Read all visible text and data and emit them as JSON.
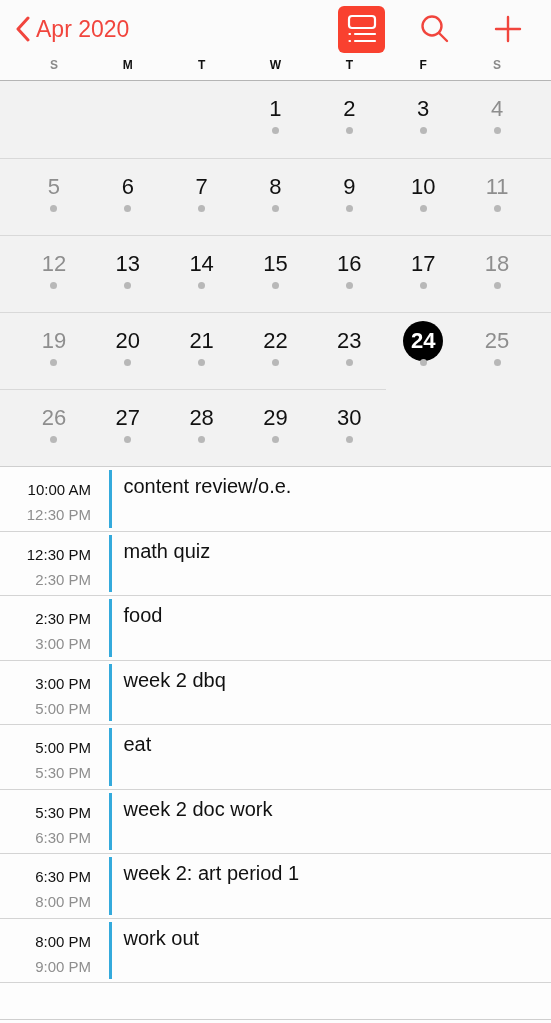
{
  "nav": {
    "back_label": "Apr 2020",
    "buttons": [
      {
        "kind": "list-view",
        "selected": true
      },
      {
        "kind": "search",
        "selected": false
      },
      {
        "kind": "add",
        "selected": false
      }
    ]
  },
  "weekdays": [
    {
      "label": "S",
      "weekend": true
    },
    {
      "label": "M",
      "weekend": false
    },
    {
      "label": "T",
      "weekend": false
    },
    {
      "label": "W",
      "weekend": false
    },
    {
      "label": "T",
      "weekend": false
    },
    {
      "label": "F",
      "weekend": false
    },
    {
      "label": "S",
      "weekend": true
    }
  ],
  "weeks": [
    [
      {
        "kind": "blank"
      },
      {
        "kind": "blank"
      },
      {
        "kind": "blank"
      },
      {
        "day": "1",
        "weekend": false,
        "selected": false,
        "has_events": true
      },
      {
        "day": "2",
        "weekend": false,
        "selected": false,
        "has_events": true
      },
      {
        "day": "3",
        "weekend": false,
        "selected": false,
        "has_events": true
      },
      {
        "day": "4",
        "weekend": true,
        "selected": false,
        "has_events": true
      }
    ],
    [
      {
        "day": "5",
        "weekend": true,
        "selected": false,
        "has_events": true
      },
      {
        "day": "6",
        "weekend": false,
        "selected": false,
        "has_events": true
      },
      {
        "day": "7",
        "weekend": false,
        "selected": false,
        "has_events": true
      },
      {
        "day": "8",
        "weekend": false,
        "selected": false,
        "has_events": true
      },
      {
        "day": "9",
        "weekend": false,
        "selected": false,
        "has_events": true
      },
      {
        "day": "10",
        "weekend": false,
        "selected": false,
        "has_events": true
      },
      {
        "day": "11",
        "weekend": true,
        "selected": false,
        "has_events": true
      }
    ],
    [
      {
        "day": "12",
        "weekend": true,
        "selected": false,
        "has_events": true
      },
      {
        "day": "13",
        "weekend": false,
        "selected": false,
        "has_events": true
      },
      {
        "day": "14",
        "weekend": false,
        "selected": false,
        "has_events": true
      },
      {
        "day": "15",
        "weekend": false,
        "selected": false,
        "has_events": true
      },
      {
        "day": "16",
        "weekend": false,
        "selected": false,
        "has_events": true
      },
      {
        "day": "17",
        "weekend": false,
        "selected": false,
        "has_events": true
      },
      {
        "day": "18",
        "weekend": true,
        "selected": false,
        "has_events": true
      }
    ],
    [
      {
        "day": "19",
        "weekend": true,
        "selected": false,
        "has_events": true
      },
      {
        "day": "20",
        "weekend": false,
        "selected": false,
        "has_events": true
      },
      {
        "day": "21",
        "weekend": false,
        "selected": false,
        "has_events": true
      },
      {
        "day": "22",
        "weekend": false,
        "selected": false,
        "has_events": true
      },
      {
        "day": "23",
        "weekend": false,
        "selected": false,
        "has_events": true
      },
      {
        "day": "24",
        "weekend": false,
        "selected": true,
        "has_events": true
      },
      {
        "day": "25",
        "weekend": true,
        "selected": false,
        "has_events": true
      }
    ],
    [
      {
        "day": "26",
        "weekend": true,
        "selected": false,
        "has_events": true
      },
      {
        "day": "27",
        "weekend": false,
        "selected": false,
        "has_events": true
      },
      {
        "day": "28",
        "weekend": false,
        "selected": false,
        "has_events": true
      },
      {
        "day": "29",
        "weekend": false,
        "selected": false,
        "has_events": true
      },
      {
        "day": "30",
        "weekend": false,
        "selected": false,
        "has_events": true
      },
      {
        "kind": "blank"
      },
      {
        "kind": "blank"
      }
    ]
  ],
  "events": [
    {
      "start": "10:00 AM",
      "end": "12:30 PM",
      "title": "content review/o.e.",
      "color": "#34aadc"
    },
    {
      "start": "12:30 PM",
      "end": "2:30 PM",
      "title": "math quiz",
      "color": "#34aadc"
    },
    {
      "start": "2:30 PM",
      "end": "3:00 PM",
      "title": "food",
      "color": "#34aadc"
    },
    {
      "start": "3:00 PM",
      "end": "5:00 PM",
      "title": "week 2 dbq",
      "color": "#34aadc"
    },
    {
      "start": "5:00 PM",
      "end": "5:30 PM",
      "title": "eat",
      "color": "#34aadc"
    },
    {
      "start": "5:30 PM",
      "end": "6:30 PM",
      "title": "week 2 doc work",
      "color": "#34aadc"
    },
    {
      "start": "6:30 PM",
      "end": "8:00 PM",
      "title": "week 2: art period 1",
      "color": "#34aadc"
    },
    {
      "start": "8:00 PM",
      "end": "9:00 PM",
      "title": "work out",
      "color": "#34aadc"
    }
  ]
}
